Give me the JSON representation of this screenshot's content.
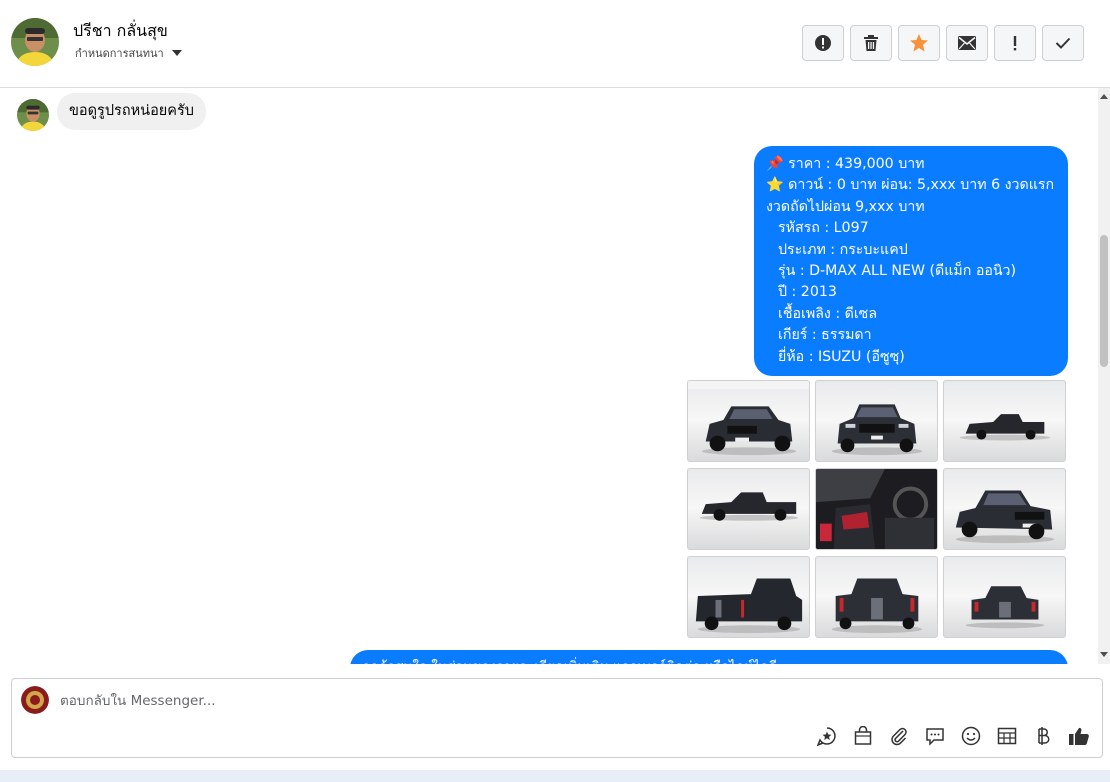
{
  "header": {
    "contact_name": "ปรีชา กลั่นสุข",
    "conversation_settings": "กำหนดการสนทนา",
    "toolbar": [
      {
        "name": "report-spam-button",
        "icon": "alert-circle-icon"
      },
      {
        "name": "delete-button",
        "icon": "trash-icon"
      },
      {
        "name": "star-button",
        "icon": "star-icon",
        "color": "#f7923b"
      },
      {
        "name": "mark-unread-button",
        "icon": "envelope-icon"
      },
      {
        "name": "mark-important-button",
        "icon": "exclamation-icon"
      },
      {
        "name": "mark-done-button",
        "icon": "check-icon"
      }
    ]
  },
  "messages": {
    "incoming": "ขอดูรูปรถหน่อยครับ",
    "listing": {
      "price": "📌 ราคา : 439,000 บาท",
      "down": "⭐ ดาวน์ : 0 บาท ผ่อน: 5,xxx บาท 6 งวดแรก",
      "next": "งวดถัดไปผ่อน  9,xxx บาท",
      "code": "รหัสรถ : L097",
      "type": "ประเภท : กระบะแคป",
      "model": "รุ่น : D-MAX ALL NEW (ดีแม็ก ออนิว)",
      "year": "ปี : 2013",
      "fuel": "เชื้อเพลิง : ดีเซล",
      "gear": "เกียร์ : ธรรมดา",
      "brand": "ยี่ห้อ : ISUZU (อีซูซุ)"
    },
    "partial": "ลูกค้าสนใจ ในส่วนของรายละเอียดเพิ่มเติม แจกเบอร์ติดต่อ หรือไลน์ไอดี"
  },
  "composer": {
    "placeholder": "ตอบกลับใน Messenger...",
    "tools": [
      "saved-reply-icon",
      "shopping-bag-icon",
      "paperclip-icon",
      "chat-bubble-icon",
      "smiley-icon",
      "table-icon",
      "baht-icon",
      "thumbs-up-icon"
    ]
  },
  "colors": {
    "outgoing_bubble": "#0a7cff",
    "incoming_bubble": "#f0f0f0",
    "star": "#f7923b"
  }
}
